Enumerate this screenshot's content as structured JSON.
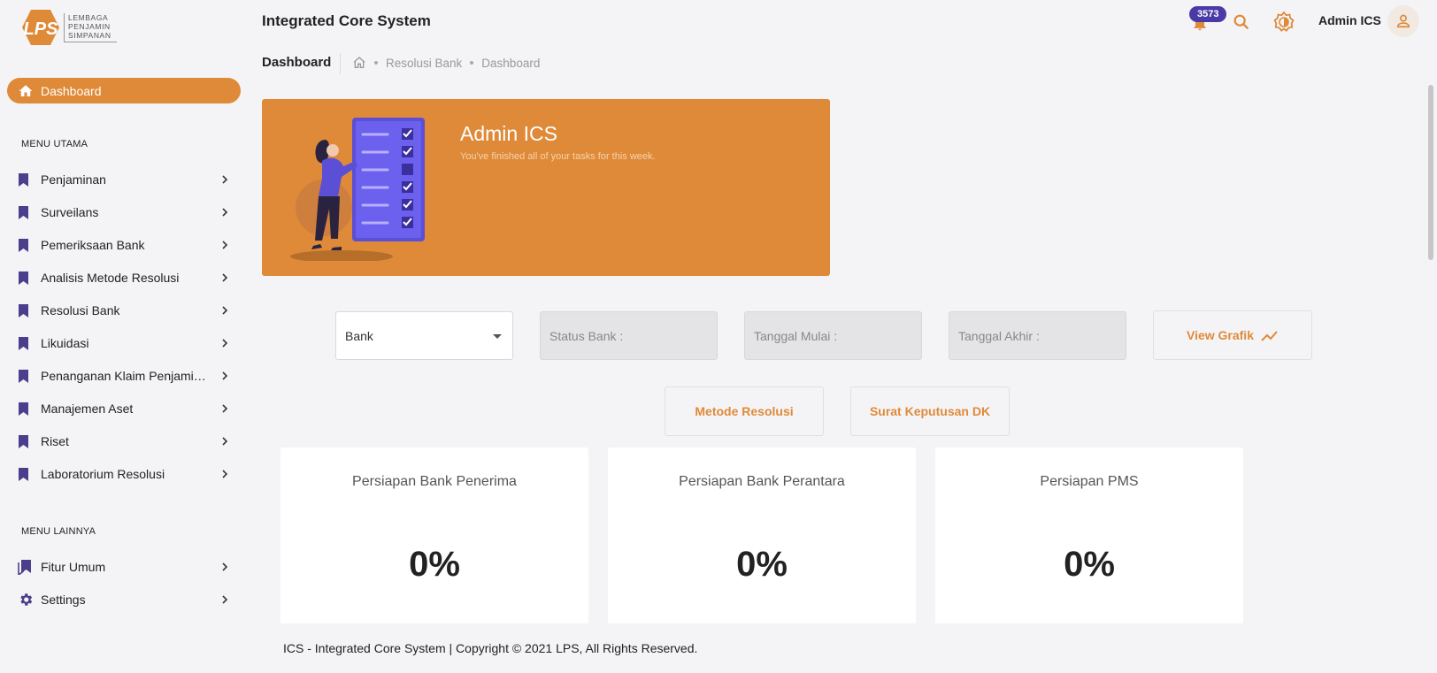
{
  "logo": {
    "line1": "LEMBAGA",
    "line2": "PENJAMIN",
    "line3": "SIMPANAN",
    "mark": "LPS"
  },
  "sidebar": {
    "active": {
      "label": "Dashboard",
      "icon": "home-icon"
    },
    "section_main": "MENU UTAMA",
    "items": [
      {
        "label": "Penjaminan"
      },
      {
        "label": "Surveilans"
      },
      {
        "label": "Pemeriksaan Bank"
      },
      {
        "label": "Analisis Metode Resolusi"
      },
      {
        "label": "Resolusi Bank"
      },
      {
        "label": "Likuidasi"
      },
      {
        "label": "Penanganan Klaim Penjaminan"
      },
      {
        "label": "Manajemen Aset"
      },
      {
        "label": "Riset"
      },
      {
        "label": "Laboratorium Resolusi"
      }
    ],
    "section_other": "MENU LAINNYA",
    "other_items": [
      {
        "label": "Fitur Umum",
        "icon": "bookmarks-icon"
      },
      {
        "label": "Settings",
        "icon": "gear-icon"
      }
    ]
  },
  "header": {
    "title": "Integrated Core System",
    "notification_count": "3573",
    "user_name": "Admin ICS"
  },
  "breadcrumb": {
    "page_title": "Dashboard",
    "items": [
      "Resolusi Bank",
      "Dashboard"
    ]
  },
  "banner": {
    "title": "Admin ICS",
    "subtitle": "You've finished all of your tasks for this week."
  },
  "filters": {
    "bank_select": "Bank",
    "status_placeholder": "Status Bank :",
    "start_placeholder": "Tanggal Mulai :",
    "end_placeholder": "Tanggal Akhir :",
    "view_chart_label": "View Grafik",
    "method_button": "Metode Resolusi",
    "decree_button": "Surat Keputusan DK"
  },
  "cards": [
    {
      "title": "Persiapan Bank Penerima",
      "value": "0%"
    },
    {
      "title": "Persiapan Bank Perantara",
      "value": "0%"
    },
    {
      "title": "Persiapan PMS",
      "value": "0%"
    }
  ],
  "footer": {
    "text": "ICS - Integrated Core System | Copyright © 2021 LPS, All Rights Reserved."
  },
  "colors": {
    "accent": "#df8a38",
    "badge": "#4a3aa8",
    "icon_purple": "#4b3f8c"
  }
}
